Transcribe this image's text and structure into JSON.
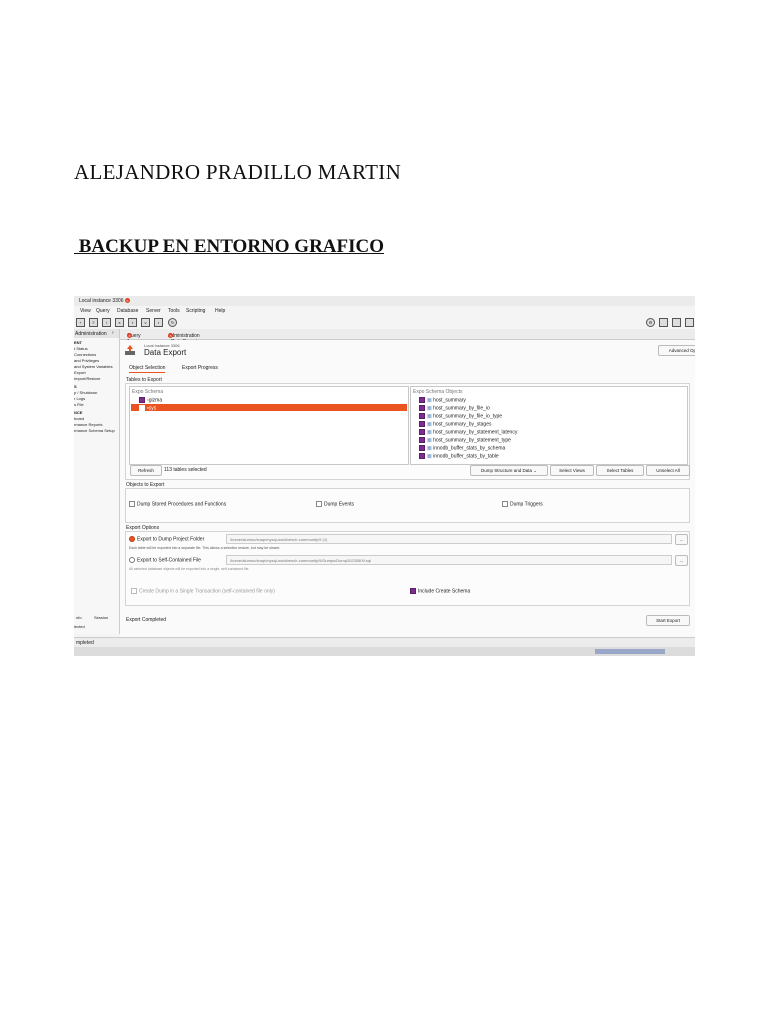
{
  "document": {
    "author": "ALEJANDRO PRADILLO MARTIN",
    "title": " BACKUP EN ENTORNO GRAFICO"
  },
  "screenshot": {
    "connection_tab": "Local instance 3306",
    "menu": [
      "View",
      "Query",
      "Database",
      "Server",
      "Tools",
      "Scripting",
      "Help"
    ],
    "sidebar": {
      "header": "Administration",
      "items": [
        "ENT",
        "t Status",
        "Connections",
        "and Privileges",
        "and System Variables",
        "Export",
        "Import/Restore",
        "S",
        "p / Shutdown",
        "r Logs",
        "s File",
        "NCE",
        "board",
        "rmance Reports",
        "rmance Schema Setup"
      ],
      "bottom_tabs": [
        "nfo",
        "Session"
      ],
      "bottom_status": "lected"
    },
    "query_tabs": [
      "Query 1",
      "Administration - Data Export"
    ],
    "page": {
      "instance": "Local instance 3306",
      "title": "Data Export",
      "advanced_button": "Advanced Options...",
      "tabs": [
        "Object Selection",
        "Export Progress"
      ]
    },
    "tables_to_export": {
      "label": "Tables to Export",
      "schema_header": "Expo Schema",
      "schemas": [
        {
          "name": "gizma",
          "checked": true,
          "selected": false
        },
        {
          "name": "sys",
          "checked": true,
          "selected": true
        }
      ],
      "objects_header": "Expo Schema Objects",
      "objects": [
        "host_summary",
        "host_summary_by_file_io",
        "host_summary_by_file_io_type",
        "host_summary_by_stages",
        "host_summary_by_statement_latency",
        "host_summary_by_statement_type",
        "innodb_buffer_stats_by_schema",
        "innodb_buffer_stats_by_table"
      ],
      "refresh": "Refresh",
      "count": "113 tables selected",
      "dump_select": "Dump Structure and Data",
      "select_views": "Select Views",
      "select_tables": "Select Tables",
      "unselect_all": "Unselect All"
    },
    "objects_to_export": {
      "label": "Objects to Export",
      "procedures": "Dump Stored Procedures and Functions",
      "events": "Dump Events",
      "triggers": "Dump Triggers"
    },
    "export_options": {
      "label": "Export Options",
      "option1": "Export to Dump Project Folder",
      "path1": "/home/alumno/snap/mysql-workbench-community/9 (1)",
      "note1": "Each table will be exported into a separate file. This allows a selective restore, but may be slower.",
      "option2": "Export to Self-Contained File",
      "path2": "/home/alumno/snap/mysql-workbench-community/9/Dumps/Dump20230509.sql",
      "note2": "All selected database objects will be exported into a single, self-contained file.",
      "transaction": "Create Dump in a Single Transaction (self-contained file only)",
      "include_schema": "Include Create Schema",
      "browse": "..."
    },
    "footer": {
      "status": "Export Completed",
      "start_export": "Start Export",
      "window_status": "mpleted"
    }
  }
}
